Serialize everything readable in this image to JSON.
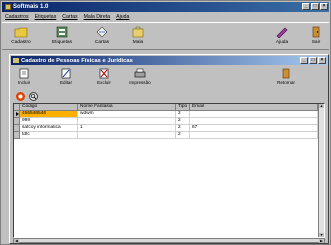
{
  "app": {
    "title": "Softmais 1.0"
  },
  "menu": [
    "Cadastros",
    "Etiquetas",
    "Cartas",
    "Mala Direta",
    "Ajuda"
  ],
  "toolbar": {
    "cadastro": "Cadastro",
    "etiquetas": "Etiquetas",
    "cartas": "Cartas",
    "mala": "Mala",
    "ajuda": "Ajuda",
    "sair": "Sair"
  },
  "child": {
    "title": "Cadastro de Pessoas Físicas e Jurídicas",
    "buttons": {
      "incluir": "Incluir",
      "editar": "Editar",
      "excluir": "Excluir",
      "impressao": "Impressão",
      "retornar": "Retornar"
    }
  },
  "grid": {
    "columns": [
      "Código",
      "Nome Fantasia",
      "Tipo",
      "Email"
    ],
    "rows": [
      [
        "456546546",
        "wdwm",
        "2",
        ""
      ],
      [
        "999",
        "",
        "2",
        ""
      ],
      [
        "safcoy informatica",
        "1",
        "2",
        "67"
      ],
      [
        "tdfc",
        "",
        "2",
        ""
      ]
    ]
  },
  "colors": {
    "titlebar": "#0a246a",
    "selected_cell": "#ffb000",
    "window_bg": "#c0c0c0"
  }
}
